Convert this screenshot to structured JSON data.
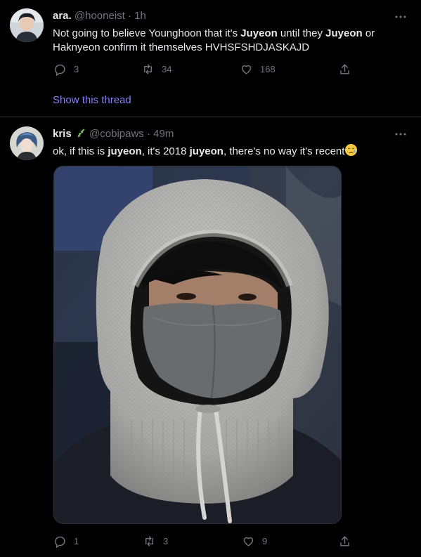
{
  "tweets": [
    {
      "name": "ara.",
      "handle": "@hooneist",
      "time": "· 1h",
      "text_parts": [
        "Not going to believe Younghoon that it's ",
        "Juyeon",
        " until they ",
        "Juyeon",
        " or Haknyeon confirm it themselves HVHSFSHDJASKAJD"
      ],
      "replies": "3",
      "retweets": "34",
      "likes": "168",
      "show_thread": "Show this thread"
    },
    {
      "name": "kris",
      "handle": "@cobipaws",
      "time": "· 49m",
      "text_parts": [
        "ok, if this is ",
        "juyeon",
        ", it's 2018 ",
        "juyeon",
        ", there's no way it's recent"
      ],
      "replies": "1",
      "retweets": "3",
      "likes": "9"
    }
  ],
  "colors": {
    "background": "#000000",
    "text": "#e7e9ea",
    "muted": "#71767b",
    "link": "#8a7ff5",
    "divider": "#2f3336"
  },
  "icons": [
    "more-icon",
    "reply-icon",
    "retweet-icon",
    "like-icon",
    "share-icon",
    "herb-icon",
    "sad-face-icon"
  ]
}
